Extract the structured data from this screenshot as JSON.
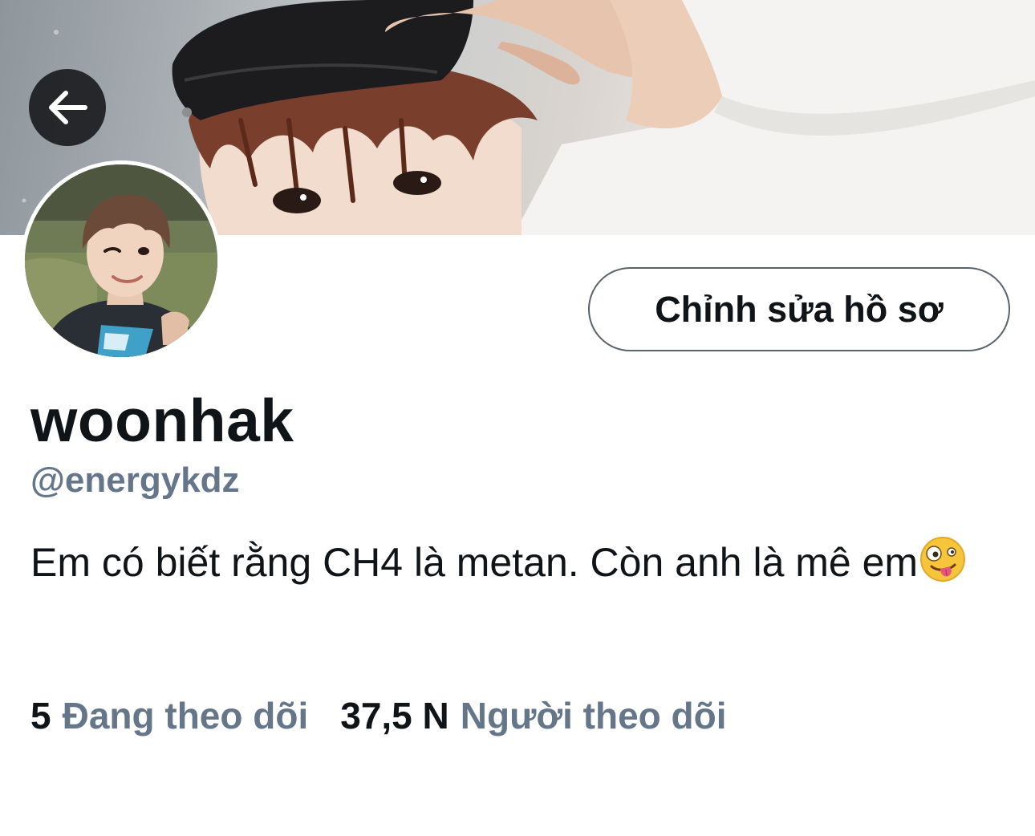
{
  "header": {
    "back_icon": "arrow-left-icon"
  },
  "profile": {
    "display_name": "woonhak",
    "handle": "@energykdz",
    "bio": "Em có biết rằng CH4 là metan. Còn anh là mê em",
    "bio_emoji": "zany-face-emoji",
    "edit_button_label": "Chỉnh sửa hồ sơ"
  },
  "stats": {
    "following_count": "5",
    "following_label": "Đang theo dõi",
    "followers_count": "37,5 N",
    "followers_label": "Người theo dõi"
  },
  "colors": {
    "text_primary": "#0f1419",
    "text_secondary": "#66768a",
    "button_border": "#59636c"
  }
}
